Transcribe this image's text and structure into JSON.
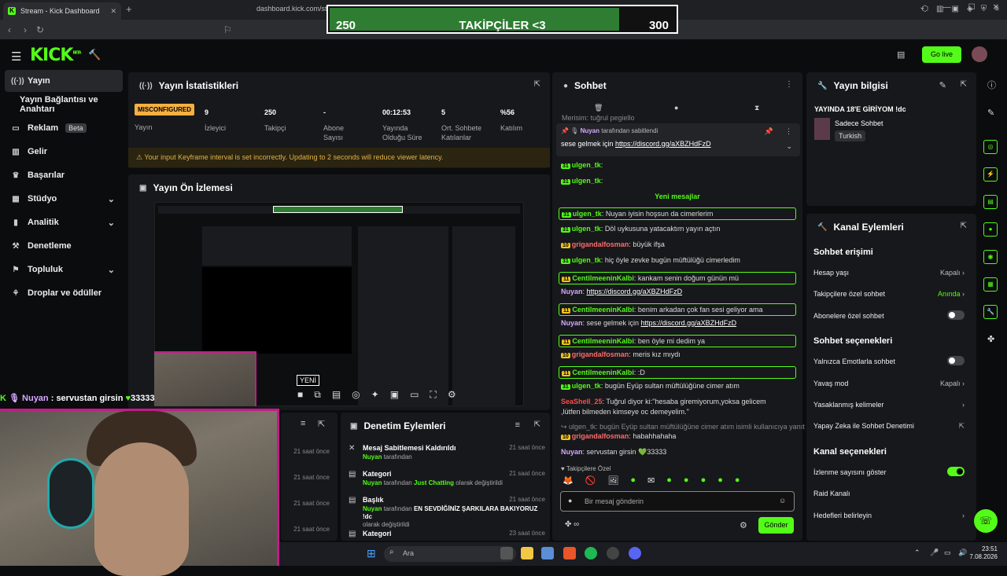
{
  "browser": {
    "tab_title": "Stream - Kick Dashboard",
    "url": "dashboard.kick.com/st"
  },
  "overlay": {
    "left": "250",
    "title": "TAKİPÇİLER <3",
    "right": "300",
    "progress": 0.83
  },
  "header": {
    "logo": "KICK",
    "logo_tag": "BETA",
    "go_live": "Go live"
  },
  "sidebar": [
    {
      "label": "Yayın",
      "icon": "broadcast-icon"
    },
    {
      "label": "Yayın Bağlantısı ve Anahtarı"
    },
    {
      "label": "Reklam",
      "badge": "Beta",
      "icon": "tv-icon"
    },
    {
      "label": "Gelir",
      "icon": "chart-icon"
    },
    {
      "label": "Başarılar",
      "icon": "trophy-icon"
    },
    {
      "label": "Stüdyo",
      "icon": "studio-icon"
    },
    {
      "label": "Analitik",
      "icon": "analytics-icon"
    },
    {
      "label": "Denetleme",
      "icon": "hammer-icon"
    },
    {
      "label": "Topluluk",
      "icon": "community-icon"
    },
    {
      "label": "Droplar ve ödüller",
      "icon": "gift-icon"
    }
  ],
  "stats": {
    "title": "Yayın İstatistikleri",
    "status": "MISCONFIGURED",
    "status_label": "Yayın",
    "items": [
      {
        "v": "9",
        "l": "İzleyici"
      },
      {
        "v": "250",
        "l": "Takipçi"
      },
      {
        "v": "-",
        "l": "Abone Sayısı"
      },
      {
        "v": "00:12:53",
        "l": "Yayında Olduğu Süre"
      },
      {
        "v": "5",
        "l": "Ort. Sohbete Katılanlar"
      },
      {
        "v": "%56",
        "l": "Katılım"
      }
    ],
    "warning": "Your input Keyframe interval is set incorrectly. Updating to 2 seconds will reduce viewer latency."
  },
  "preview": {
    "title": "Yayın Ön İzlemesi",
    "new_badge": "YENİ"
  },
  "webcam_chat": {
    "user": "Nuyan",
    "msg": ": servustan girsin",
    "amount": "33333"
  },
  "mod": {
    "title": "Denetim Eylemleri",
    "left_times": [
      "21 saat önce",
      "21 saat önce",
      "21 saat önce",
      "21 saat önce"
    ],
    "rows": [
      {
        "t": "Mesaj Sabitlemesi Kaldırıldı",
        "by": "Nuyan",
        "s": "tarafından",
        "time": "21 saat önce"
      },
      {
        "t": "Kategori",
        "by": "Nuyan",
        "s": "tarafından",
        "extra": "Just Chatting",
        "s2": "olarak değiştirildi",
        "time": "21 saat önce"
      },
      {
        "t": "Başlık",
        "by": "Nuyan",
        "s": "tarafından",
        "extra": "EN SEVDİĞİNİZ ŞARKILARA BAKIYORUZ !dc",
        "s2": "olarak değiştirildi",
        "time": "21 saat önce"
      },
      {
        "t": "Kategori",
        "time": "23 saat önce"
      }
    ]
  },
  "chat": {
    "title": "Sohbet",
    "top_partial": "Merisim: tuğrul pegiello",
    "pinned_by": "Nuyan",
    "pinned_suffix": "tarafından sabitlendi",
    "pinned_text": "sese gelmek için",
    "pinned_link": "https://discord.gg/aXBZHdFzD",
    "new_label": "Yeni mesajlar",
    "messages": [
      {
        "b": "31",
        "u": "ulgen_tk",
        "c": "#53fc18",
        "t": ": "
      },
      {
        "b": "31",
        "u": "ulgen_tk",
        "c": "#53fc18",
        "t": ": "
      },
      {
        "b": "31",
        "u": "ulgen_tk",
        "c": "#53fc18",
        "t": ": Nuyan iyisin hoşsun da cimerlerim",
        "hl": true
      },
      {
        "b": "31",
        "u": "ulgen_tk",
        "c": "#53fc18",
        "t": ": Döl uykusuna yatacaktım yayın açtın"
      },
      {
        "b": "10",
        "u": "grigandalfosman",
        "c": "#ff6b6b",
        "t": ": büyük ifşa"
      },
      {
        "b": "31",
        "u": "ulgen_tk",
        "c": "#53fc18",
        "t": ": hiç öyle zevke bugün müftülüğü cimerledim"
      },
      {
        "b": "11",
        "u": "CentilmeeninKalbi",
        "c": "#53fc18",
        "t": ": kankam senin doğum günün mü",
        "hl": true
      },
      {
        "b": "",
        "u": "Nuyan",
        "c": "#d6a8ff",
        "t": ": ",
        "link": "https://discord.gg/aXBZHdFzD"
      },
      {
        "b": "11",
        "u": "CentilmeeninKalbi",
        "c": "#53fc18",
        "t": ": benim arkadan çok fan sesi geliyor ama",
        "hl": true
      },
      {
        "b": "",
        "u": "Nuyan",
        "c": "#d6a8ff",
        "t": ": sese gelmek için ",
        "link": "https://discord.gg/aXBZHdFzD"
      },
      {
        "b": "11",
        "u": "CentilmeeninKalbi",
        "c": "#53fc18",
        "t": ": ben öyle mi dedim ya",
        "hl": true
      },
      {
        "b": "10",
        "u": "grigandalfosman",
        "c": "#ff6b6b",
        "t": ": meris kız mıydı"
      },
      {
        "b": "11",
        "u": "CentilmeeninKalbi",
        "c": "#53fc18",
        "t": ": :D",
        "hl": true
      },
      {
        "b": "31",
        "u": "ulgen_tk",
        "c": "#53fc18",
        "t": ": bugün Eyüp sultan müftülüğüne cimer atım"
      },
      {
        "b": "",
        "u": "SeaShell_25",
        "c": "#ff4d4d",
        "t": ": Tuğrul diyor ki:''hesaba giremiyorum,yoksa gelicem"
      },
      {
        "b": "",
        "u": "",
        "c": "#ddd",
        "t": ",lütfen bilmeden kimseye oc demeyelim.''"
      },
      {
        "b": "",
        "u": "",
        "c": "#888",
        "t": "↪ ulgen_tk: bugün Eyüp sultan müftülüğüne cimer atım isimli kullanıcıya yanıt v..."
      },
      {
        "b": "10",
        "u": "grigandalfosman",
        "c": "#ff6b6b",
        "t": ": habahhahaha"
      },
      {
        "b": "",
        "u": "Nuyan",
        "c": "#d6a8ff",
        "t": ": servustan girsin 💚33333"
      }
    ],
    "followers_label": "♥ Takipçilere Özel",
    "input_placeholder": "Bir mesaj gönderin",
    "send": "Gönder"
  },
  "info": {
    "title": "Yayın bilgisi",
    "stream_title": "YAYINDA 18'E GİRİYOM !dc",
    "category": "Sadece Sohbet",
    "tag": "Turkish"
  },
  "channel": {
    "title": "Kanal Eylemleri",
    "sec1": "Sohbet erişimi",
    "o1": [
      {
        "l": "Hesap yaşı",
        "v": "Kapalı"
      },
      {
        "l": "Takipçilere özel sohbet",
        "v": "Anında"
      },
      {
        "l": "Abonelere özel sohbet",
        "toggle": false
      }
    ],
    "sec2": "Sohbet seçenekleri",
    "o2": [
      {
        "l": "Yalnızca Emotlarla sohbet",
        "toggle": false
      },
      {
        "l": "Yavaş mod",
        "v": "Kapalı"
      },
      {
        "l": "Yasaklanmış kelimeler"
      },
      {
        "l": "Yapay Zeka ile Sohbet Denetimi"
      }
    ],
    "sec3": "Kanal seçenekleri",
    "o3": [
      {
        "l": "İzlenme sayısını göster",
        "toggle": true
      },
      {
        "l": "Raid Kanalı"
      },
      {
        "l": "Hedefleri belirleyin"
      }
    ]
  },
  "taskbar": {
    "search": "Ara",
    "time": "23:51",
    "date": "7.08.2026"
  }
}
